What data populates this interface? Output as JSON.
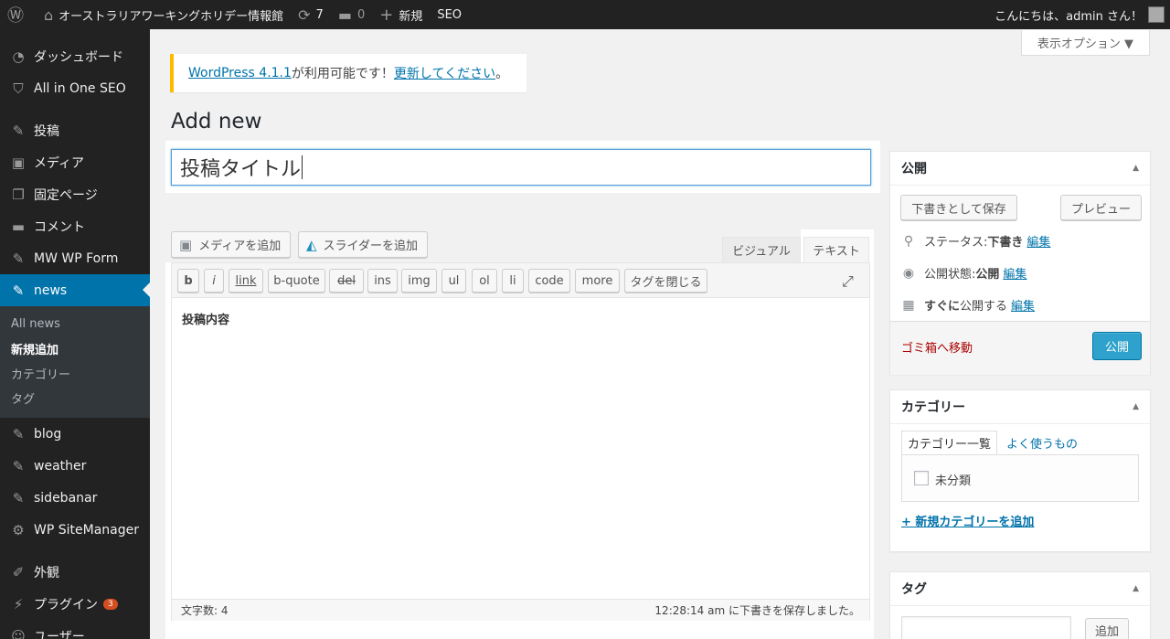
{
  "adminbar": {
    "site_name": "オーストラリアワーキングホリデー情報館",
    "updates_count": "7",
    "comments_count": "0",
    "new_label": "新規",
    "seo_label": "SEO",
    "greeting": "こんにちは、admin さん！"
  },
  "sidebar": {
    "items": [
      {
        "label": "ダッシュボード"
      },
      {
        "label": "All in One SEO"
      },
      {
        "label": "投稿"
      },
      {
        "label": "メディア"
      },
      {
        "label": "固定ページ"
      },
      {
        "label": "コメント"
      },
      {
        "label": "MW WP Form"
      },
      {
        "label": "news"
      },
      {
        "label": "blog"
      },
      {
        "label": "weather"
      },
      {
        "label": "sidebanar"
      },
      {
        "label": "WP SiteManager"
      },
      {
        "label": "外観"
      },
      {
        "label": "プラグイン"
      },
      {
        "label": "ユーザー"
      }
    ],
    "plugins_badge": "3",
    "submenu": [
      "All news",
      "新規追加",
      "カテゴリー",
      "タグ"
    ]
  },
  "screen_options": "表示オプション ▼",
  "notice": {
    "link1": "WordPress 4.1.1",
    "text": " が利用可能です！",
    "link2": "更新してください",
    "end": "。"
  },
  "page_title": "Add new",
  "title_value": "投稿タイトル",
  "media_buttons": {
    "add_media": "メディアを追加",
    "add_slider": "スライダーを追加"
  },
  "editor_tabs": {
    "visual": "ビジュアル",
    "text": "テキスト"
  },
  "quicktags": [
    "b",
    "i",
    "link",
    "b-quote",
    "del",
    "ins",
    "img",
    "ul",
    "ol",
    "li",
    "code",
    "more",
    "タグを閉じる"
  ],
  "editor_content": "投稿内容",
  "status": {
    "word_count": "文字数: 4",
    "autosave": "12:28:14 am に下書きを保存しました。"
  },
  "publish_box": {
    "title": "公開",
    "save_draft": "下書きとして保存",
    "preview": "プレビュー",
    "status_label": "ステータス: ",
    "status_value": "下書き",
    "visibility_label": "公開状態: ",
    "visibility_value": "公開",
    "schedule_bold": "すぐに",
    "schedule_label": "公開する",
    "edit": "編集",
    "trash": "ゴミ箱へ移動",
    "publish": "公開"
  },
  "category_box": {
    "title": "カテゴリー",
    "tab_all": "カテゴリー一覧",
    "tab_popular": "よく使うもの",
    "item": "未分類",
    "add_new": "+ 新規カテゴリーを追加"
  },
  "tag_box": {
    "title": "タグ",
    "add": "追加"
  },
  "colors": {
    "admin_bar": "#222222",
    "accent": "#0073aa",
    "publish": "#2ea2cc",
    "notice_border": "#ffba00",
    "trash": "#aa0000"
  }
}
